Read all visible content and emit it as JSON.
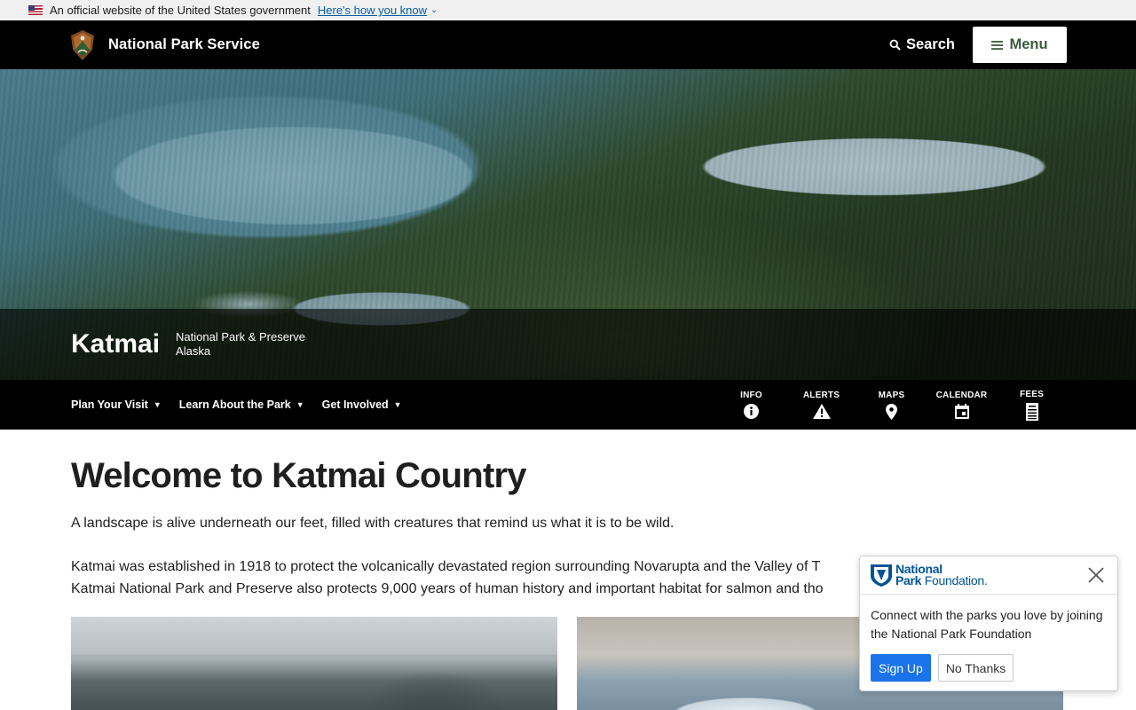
{
  "gov_banner": {
    "text": "An official website of the United States government",
    "link": "Here's how you know",
    "flag_icon": "us-flag-icon",
    "chevron_icon": "chevron-down-icon"
  },
  "header": {
    "site_title": "National Park Service",
    "logo_icon": "nps-arrowhead-icon",
    "search_label": "Search",
    "menu_label": "Menu"
  },
  "hero": {
    "park_name": "Katmai",
    "designation": "National Park & Preserve",
    "state": "Alaska"
  },
  "subnav": {
    "items": [
      {
        "label": "Plan Your Visit"
      },
      {
        "label": "Learn About the Park"
      },
      {
        "label": "Get Involved"
      }
    ],
    "quick_links": [
      {
        "label": "INFO",
        "icon": "info-icon"
      },
      {
        "label": "ALERTS",
        "icon": "alert-icon"
      },
      {
        "label": "MAPS",
        "icon": "map-pin-icon"
      },
      {
        "label": "CALENDAR",
        "icon": "calendar-icon"
      },
      {
        "label": "FEES",
        "icon": "fees-icon"
      }
    ]
  },
  "main": {
    "title": "Welcome to Katmai Country",
    "intro": "A landscape is alive underneath our feet, filled with creatures that remind us what it is to be wild.",
    "body_line1": "Katmai was established in 1918 to protect the volcanically devastated region surrounding Novarupta and the Valley of T",
    "body_line2": "Katmai National Park and Preserve also protects 9,000 years of human history and important habitat for salmon and tho"
  },
  "npf_popup": {
    "brand_line1": "National",
    "brand_line2a": "Park",
    "brand_line2b": "Foundation.",
    "message": "Connect with the parks you love by joining the National Park Foundation",
    "signup_label": "Sign Up",
    "nothanks_label": "No Thanks"
  },
  "colors": {
    "header_bg": "#000000",
    "gov_banner_bg": "#f0f0f0",
    "link_blue": "#005ea2",
    "menu_text": "#3d5a3d",
    "npf_blue": "#005496",
    "signup_blue": "#1a73e8"
  }
}
